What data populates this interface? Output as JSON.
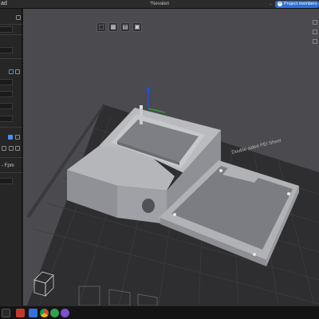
{
  "titlebar": {
    "app_label": "ad",
    "document_title": "*Nevalen",
    "back_glyph": "←",
    "project_button_label": "Project members"
  },
  "toolbar": {
    "buttons": [
      {
        "name": "view-cube-icon",
        "glyph": "⬚"
      },
      {
        "name": "grid-view-icon",
        "glyph": "▦"
      },
      {
        "name": "layers-icon",
        "glyph": "▤"
      },
      {
        "name": "preview-icon",
        "glyph": "▣"
      }
    ]
  },
  "panel": {
    "text_row_value": "- Fpm",
    "accent_color": "#4a8ef0"
  },
  "viewport": {
    "bed_label": "Double sided PEI Sheet",
    "background_color": "#4a4a4f",
    "bed_color": "#2e2e30",
    "model_color": "#a8aaaf"
  },
  "taskbar": {
    "icons": [
      "start-icon",
      "app-icon-red",
      "app-icon-blue",
      "chrome-icon",
      "app-icon-green",
      "viber-icon"
    ]
  }
}
